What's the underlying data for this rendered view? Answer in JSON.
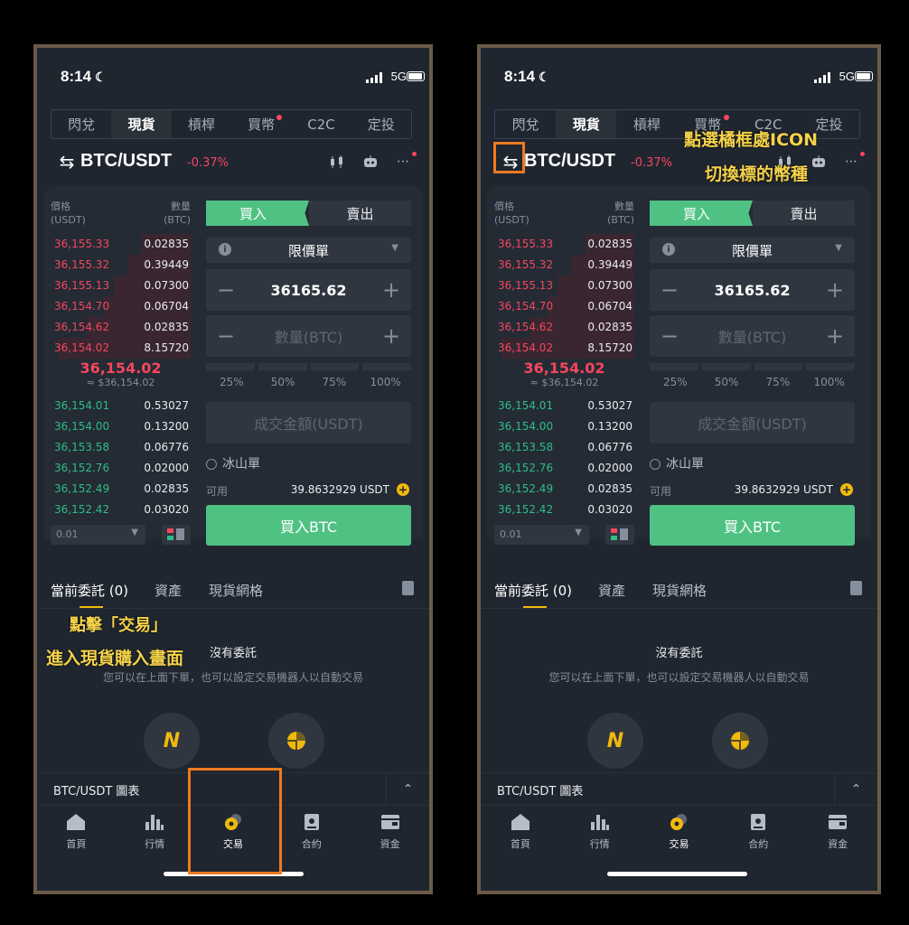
{
  "status": {
    "time": "8:14",
    "network": "5G"
  },
  "tabs": [
    {
      "label": "閃兌",
      "active": false
    },
    {
      "label": "現貨",
      "active": true
    },
    {
      "label": "槓桿",
      "active": false
    },
    {
      "label": "買幣",
      "active": false,
      "dot": true
    },
    {
      "label": "C2C",
      "active": false
    },
    {
      "label": "定投",
      "active": false
    }
  ],
  "pair": {
    "name": "BTC/USDT",
    "change": "-0.37%"
  },
  "orderbook": {
    "price_label": "價格",
    "price_unit": "(USDT)",
    "qty_label": "數量",
    "qty_unit": "(BTC)",
    "asks": [
      {
        "price": "36,155.33",
        "qty": "0.02835",
        "depth": 0.35
      },
      {
        "price": "36,155.32",
        "qty": "0.39449",
        "depth": 0.45
      },
      {
        "price": "36,155.13",
        "qty": "0.07300",
        "depth": 0.55
      },
      {
        "price": "36,154.70",
        "qty": "0.06704",
        "depth": 0.62
      },
      {
        "price": "36,154.62",
        "qty": "0.02835",
        "depth": 0.75
      },
      {
        "price": "36,154.02",
        "qty": "8.15720",
        "depth": 0.95
      }
    ],
    "mid_price": "36,154.02",
    "mid_fiat": "≈ $36,154.02",
    "bids": [
      {
        "price": "36,154.01",
        "qty": "0.53027"
      },
      {
        "price": "36,154.00",
        "qty": "0.13200"
      },
      {
        "price": "36,153.58",
        "qty": "0.06776"
      },
      {
        "price": "36,152.76",
        "qty": "0.02000"
      },
      {
        "price": "36,152.49",
        "qty": "0.02835"
      },
      {
        "price": "36,152.42",
        "qty": "0.03020"
      }
    ],
    "depth_select": "0.01"
  },
  "form": {
    "buy_tab": "買入",
    "sell_tab": "賣出",
    "order_type": "限價單",
    "price_value": "36165.62",
    "amount_placeholder": "數量(BTC)",
    "percents": [
      "25%",
      "50%",
      "75%",
      "100%"
    ],
    "total_placeholder": "成交金額(USDT)",
    "iceberg": "冰山單",
    "available_label": "可用",
    "available_value": "39.8632929 USDT",
    "buy_button": "買入BTC"
  },
  "orders": {
    "tabs": [
      "當前委託 (0)",
      "資產",
      "現貨網格"
    ],
    "empty_title": "沒有委託",
    "empty_sub": "您可以在上面下單，也可以設定交易機器人以自動交易"
  },
  "chart_bar": "BTC/USDT 圖表",
  "bottom_nav": [
    {
      "label": "首頁",
      "icon": "home-icon"
    },
    {
      "label": "行情",
      "icon": "markets-icon"
    },
    {
      "label": "交易",
      "icon": "trade-icon",
      "active": true
    },
    {
      "label": "合約",
      "icon": "futures-icon"
    },
    {
      "label": "資金",
      "icon": "wallet-icon"
    }
  ],
  "annotations": {
    "left_line1": "點擊「交易」",
    "left_line2": "進入現貨購入畫面",
    "right_line1": "點選橘框處ICON",
    "right_line2": "切換標的幣種"
  },
  "colors": {
    "accent_buy": "#4fc283",
    "ask": "#f6465d",
    "bid": "#2ebd85",
    "highlight": "#ee7a1f",
    "annotation": "#f5d24a"
  }
}
